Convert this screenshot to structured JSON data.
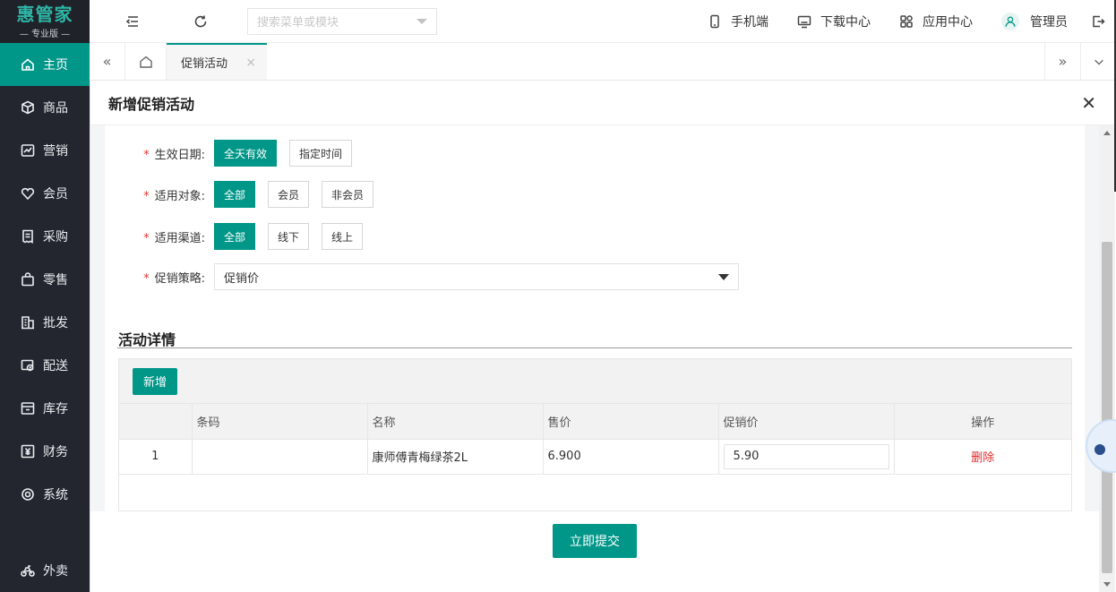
{
  "brand": {
    "name": "惠管家",
    "edition": "— 专业版 —"
  },
  "sidebar": {
    "items": [
      {
        "label": "主页",
        "icon": "home-icon"
      },
      {
        "label": "商品",
        "icon": "box-icon"
      },
      {
        "label": "营销",
        "icon": "chart-icon"
      },
      {
        "label": "会员",
        "icon": "heart-icon"
      },
      {
        "label": "采购",
        "icon": "receipt-icon"
      },
      {
        "label": "零售",
        "icon": "bag-icon"
      },
      {
        "label": "批发",
        "icon": "building-icon"
      },
      {
        "label": "配送",
        "icon": "delivery-icon"
      },
      {
        "label": "库存",
        "icon": "inventory-icon"
      },
      {
        "label": "财务",
        "icon": "finance-icon"
      },
      {
        "label": "系统",
        "icon": "settings-icon"
      }
    ],
    "bottom": {
      "label": "外卖",
      "icon": "bike-icon"
    }
  },
  "header": {
    "search_placeholder": "搜索菜单或模块",
    "mobile": "手机端",
    "download": "下载中心",
    "apps": "应用中心",
    "user": "管理员"
  },
  "tabs": {
    "active": "促销活动",
    "close": "×"
  },
  "modal": {
    "title": "新增促销活动",
    "fields": {
      "date": {
        "label": "生效日期:",
        "options": [
          "全天有效",
          "指定时间"
        ],
        "selected": 0
      },
      "target": {
        "label": "适用对象:",
        "options": [
          "全部",
          "会员",
          "非会员"
        ],
        "selected": 0
      },
      "channel": {
        "label": "适用渠道:",
        "options": [
          "全部",
          "线下",
          "线上"
        ],
        "selected": 0
      },
      "strategy": {
        "label": "促销策略:",
        "value": "促销价"
      }
    },
    "required_mark": "*",
    "detail_title": "活动详情",
    "add_button": "新增",
    "table": {
      "headers": [
        "",
        "条码",
        "名称",
        "售价",
        "促销价",
        "操作"
      ],
      "rows": [
        {
          "index": "1",
          "barcode": "",
          "name": "康师傅青梅绿茶2L",
          "price": "6.900",
          "promo_price": "5.90",
          "action": "删除"
        }
      ]
    },
    "submit": "立即提交"
  },
  "colors": {
    "accent": "#009688",
    "sidebar": "#23262e",
    "danger": "#e02b2b"
  }
}
